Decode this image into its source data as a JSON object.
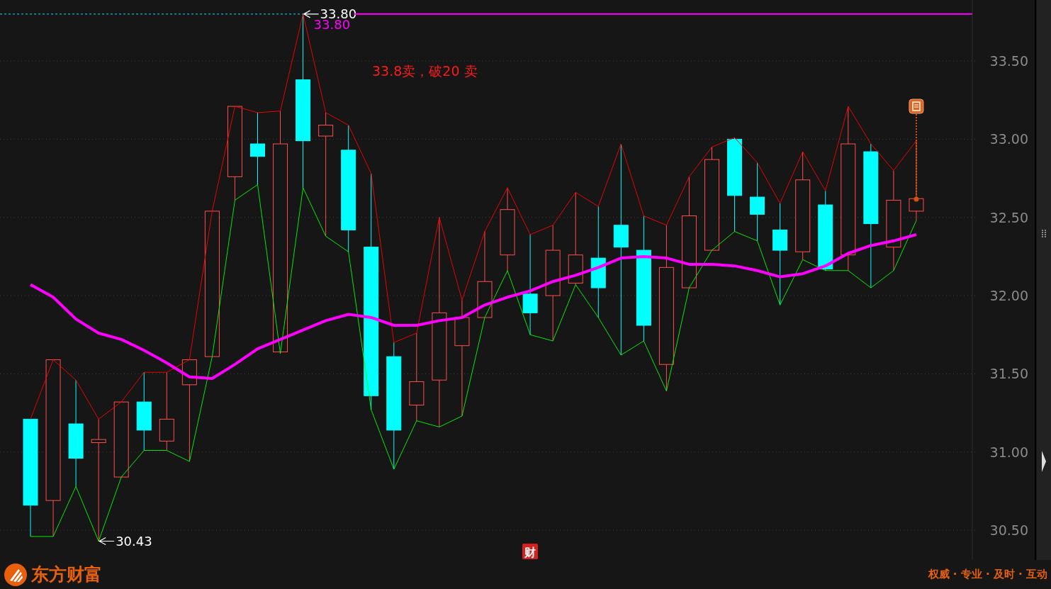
{
  "chart": {
    "chart_data": {
      "type": "line",
      "grid": true,
      "ylim": [
        30.31,
        33.89
      ],
      "yticks": [
        {
          "value": 30.5,
          "label": "30.50"
        },
        {
          "value": 31,
          "label": "31.00"
        },
        {
          "value": 31.5,
          "label": "31.50"
        },
        {
          "value": 32,
          "label": "32.00"
        },
        {
          "value": 32.5,
          "label": "32.50"
        },
        {
          "value": 33,
          "label": "33.00"
        },
        {
          "value": 33.5,
          "label": "33.50"
        }
      ],
      "series": [
        {
          "color": "#ff0000",
          "values": [
            31.21,
            31.59,
            31.46,
            31.21,
            31.32,
            31.51,
            31.51,
            31.59,
            32.54,
            33.21,
            33.17,
            33.18,
            33.8,
            33.17,
            33.09,
            32.78,
            31.7,
            31.76,
            32.5,
            31.97,
            32.41,
            32.69,
            32.39,
            32.45,
            32.66,
            32.57,
            32.97,
            32.51,
            32.45,
            32.76,
            32.95,
            33.01,
            32.85,
            32.59,
            32.92,
            32.67,
            33.21,
            32.97,
            32.8,
            32.99
          ]
        },
        {
          "color": "#00ff00",
          "values": [
            30.46,
            30.46,
            30.78,
            30.43,
            30.84,
            31.01,
            31.01,
            30.94,
            31.61,
            32.61,
            32.71,
            31.63,
            32.69,
            32.38,
            32.28,
            31.27,
            30.89,
            31.2,
            31.16,
            31.23,
            31.86,
            32.16,
            31.75,
            31.71,
            32.07,
            31.86,
            31.62,
            31.71,
            31.39,
            32.05,
            32.29,
            32.41,
            32.35,
            31.94,
            32.23,
            32.16,
            32.16,
            32.05,
            32.16,
            32.48
          ]
        },
        {
          "color": "#ff00ff",
          "values": [
            32.07,
            31.99,
            31.85,
            31.76,
            31.72,
            31.65,
            31.57,
            31.48,
            31.47,
            31.56,
            31.66,
            31.72,
            31.78,
            31.84,
            31.88,
            31.86,
            31.81,
            31.81,
            31.84,
            31.86,
            31.94,
            31.99,
            32.03,
            32.09,
            32.13,
            32.18,
            32.24,
            32.25,
            32.24,
            32.2,
            32.2,
            32.19,
            32.16,
            32.12,
            32.14,
            32.19,
            32.27,
            32.32,
            32.35,
            32.39
          ]
        }
      ],
      "annotations": [
        "33.80",
        "30.43"
      ]
    },
    "price_line": {
      "label": "33.80"
    },
    "note": "33.8卖，破20 卖",
    "badge": "财"
  },
  "footer": {
    "brand": "东方财富",
    "slogan": "权威 · 专业 · 及时 · 互动"
  }
}
